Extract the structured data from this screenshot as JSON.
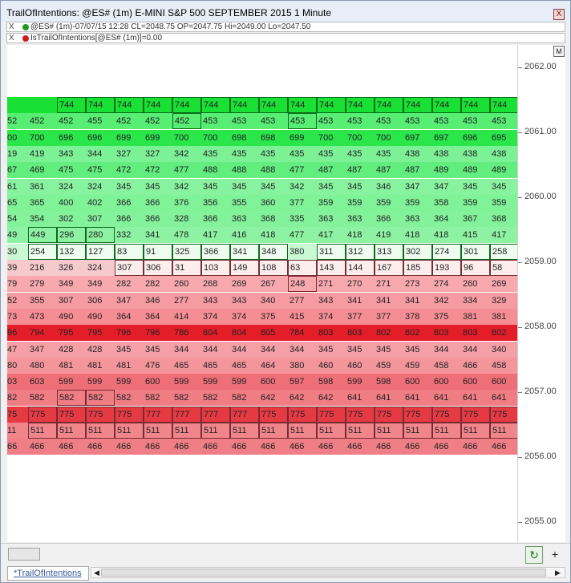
{
  "window": {
    "title": "TrailOfIntentions: @ES# (1m) E-MINI S&P 500 SEPTEMBER 2015 1 Minute",
    "close_label": "X"
  },
  "series": [
    {
      "close_label": "X",
      "dot_color": "#1f9b1f",
      "text": "@ES# (1m)-07/07/15 12:28 CL=2048.75 OP=2047.75 Hi=2049.00 Lo=2047.50"
    },
    {
      "close_label": "X",
      "dot_color": "#d01a1a",
      "text": "IsTrailOfIntentions[@ES# (1m)]=0.00"
    }
  ],
  "axis": {
    "m_label": "M",
    "labels": [
      "2062.00",
      "2061.00",
      "2060.00",
      "2059.00",
      "2058.00",
      "2057.00",
      "2056.00",
      "2055.00"
    ]
  },
  "heatmap": {
    "columns": 18,
    "rows": [
      {
        "bg": "#18e034",
        "values": [
          "",
          "",
          "744",
          "744",
          "744",
          "744",
          "744",
          "744",
          "744",
          "744",
          "744",
          "744",
          "744",
          "744",
          "744",
          "744",
          "744",
          "744"
        ],
        "boxed": [
          2,
          3,
          4,
          5,
          6,
          7,
          8,
          9,
          10,
          11,
          12,
          13,
          14,
          15,
          16,
          17
        ]
      },
      {
        "bg": "#57ee73",
        "values": [
          "52",
          "452",
          "452",
          "455",
          "452",
          "452",
          "452",
          "453",
          "453",
          "453",
          "453",
          "453",
          "453",
          "453",
          "453",
          "453",
          "453",
          "453"
        ],
        "boxed": [
          6,
          10
        ]
      },
      {
        "bg": "#2ae64b",
        "values": [
          "00",
          "700",
          "696",
          "696",
          "699",
          "699",
          "700",
          "700",
          "698",
          "698",
          "699",
          "700",
          "700",
          "700",
          "697",
          "697",
          "696",
          "695"
        ],
        "boxed": []
      },
      {
        "bg": "#7cf195",
        "values": [
          "19",
          "419",
          "343",
          "344",
          "327",
          "327",
          "342",
          "435",
          "435",
          "435",
          "435",
          "435",
          "435",
          "435",
          "438",
          "438",
          "438",
          "438"
        ],
        "boxed": []
      },
      {
        "bg": "#62ee7e",
        "values": [
          "67",
          "469",
          "475",
          "475",
          "472",
          "472",
          "477",
          "488",
          "488",
          "488",
          "477",
          "487",
          "487",
          "487",
          "487",
          "489",
          "489",
          "489"
        ],
        "boxed": []
      },
      {
        "bg": "#88f39e",
        "values": [
          "61",
          "361",
          "324",
          "324",
          "345",
          "345",
          "342",
          "345",
          "345",
          "345",
          "342",
          "345",
          "345",
          "346",
          "347",
          "347",
          "345",
          "345"
        ],
        "boxed": []
      },
      {
        "bg": "#80f298",
        "values": [
          "65",
          "365",
          "400",
          "402",
          "366",
          "366",
          "376",
          "356",
          "355",
          "360",
          "377",
          "359",
          "359",
          "359",
          "359",
          "358",
          "359",
          "359"
        ],
        "boxed": []
      },
      {
        "bg": "#84f29b",
        "values": [
          "54",
          "354",
          "302",
          "307",
          "366",
          "366",
          "328",
          "366",
          "363",
          "368",
          "335",
          "363",
          "363",
          "366",
          "363",
          "364",
          "367",
          "368"
        ],
        "boxed": []
      },
      {
        "bg": "#8df3a2",
        "values": [
          "49",
          "449",
          "296",
          "280",
          "332",
          "341",
          "478",
          "417",
          "416",
          "418",
          "477",
          "417",
          "418",
          "419",
          "418",
          "418",
          "415",
          "417"
        ],
        "boxed": [
          1,
          2,
          3
        ]
      },
      {
        "bg": "#c9f8d3",
        "values": [
          "30",
          "254",
          "132",
          "127",
          "83",
          "91",
          "325",
          "366",
          "341",
          "348",
          "380",
          "311",
          "312",
          "313",
          "302",
          "274",
          "301",
          "258"
        ],
        "boxed": [
          1,
          2,
          3,
          4,
          5,
          6,
          7,
          8,
          9,
          11,
          12,
          13,
          14,
          15,
          16,
          17
        ]
      },
      {
        "bg": "#f6c9cc",
        "values": [
          "39",
          "216",
          "326",
          "324",
          "307",
          "306",
          "31",
          "103",
          "149",
          "108",
          "63",
          "143",
          "144",
          "167",
          "185",
          "193",
          "96",
          "58"
        ],
        "boxed": [
          4,
          5,
          6,
          7,
          8,
          9,
          10,
          11,
          12,
          13,
          14,
          15,
          16,
          17
        ]
      },
      {
        "bg": "#f7a9ae",
        "values": [
          "79",
          "279",
          "349",
          "349",
          "282",
          "282",
          "260",
          "268",
          "269",
          "267",
          "248",
          "271",
          "270",
          "271",
          "273",
          "274",
          "260",
          "269"
        ],
        "boxed": [
          10
        ]
      },
      {
        "bg": "#f59ba1",
        "values": [
          "52",
          "355",
          "307",
          "306",
          "347",
          "346",
          "277",
          "343",
          "343",
          "340",
          "277",
          "343",
          "341",
          "341",
          "341",
          "342",
          "334",
          "329"
        ],
        "boxed": []
      },
      {
        "bg": "#f58d94",
        "values": [
          "73",
          "473",
          "490",
          "490",
          "364",
          "364",
          "414",
          "374",
          "374",
          "375",
          "415",
          "374",
          "377",
          "377",
          "378",
          "375",
          "381",
          "381"
        ],
        "boxed": []
      },
      {
        "bg": "#e41e28",
        "values": [
          "96",
          "794",
          "795",
          "795",
          "796",
          "796",
          "786",
          "804",
          "804",
          "805",
          "784",
          "803",
          "803",
          "802",
          "802",
          "803",
          "803",
          "802"
        ],
        "boxed": []
      },
      {
        "bg": "#f4a0a6",
        "values": [
          "47",
          "347",
          "428",
          "428",
          "345",
          "345",
          "344",
          "344",
          "344",
          "344",
          "344",
          "345",
          "345",
          "345",
          "345",
          "344",
          "344",
          "340"
        ],
        "boxed": []
      },
      {
        "bg": "#f3959b",
        "values": [
          "80",
          "480",
          "481",
          "481",
          "481",
          "476",
          "465",
          "465",
          "465",
          "464",
          "380",
          "460",
          "460",
          "459",
          "459",
          "458",
          "466",
          "458"
        ],
        "boxed": []
      },
      {
        "bg": "#ee6f78",
        "values": [
          "03",
          "603",
          "599",
          "599",
          "599",
          "600",
          "599",
          "599",
          "599",
          "600",
          "597",
          "598",
          "599",
          "598",
          "600",
          "600",
          "600",
          "600"
        ],
        "boxed": []
      },
      {
        "bg": "#f07c84",
        "values": [
          "82",
          "582",
          "582",
          "582",
          "582",
          "582",
          "582",
          "582",
          "582",
          "642",
          "642",
          "642",
          "641",
          "641",
          "641",
          "641",
          "641",
          "641"
        ],
        "boxed": [
          2,
          3
        ]
      },
      {
        "bg": "#e63a43",
        "values": [
          "75",
          "775",
          "775",
          "775",
          "775",
          "777",
          "777",
          "777",
          "777",
          "775",
          "775",
          "775",
          "775",
          "775",
          "775",
          "775",
          "775",
          "775"
        ],
        "boxed": [
          1,
          2,
          3,
          4,
          5,
          6,
          7,
          8,
          9,
          10,
          11,
          12,
          13,
          14,
          15,
          16,
          17
        ]
      },
      {
        "bg": "#f0858c",
        "values": [
          "11",
          "511",
          "511",
          "511",
          "511",
          "511",
          "511",
          "511",
          "511",
          "511",
          "511",
          "511",
          "511",
          "511",
          "511",
          "511",
          "511",
          "511"
        ],
        "boxed": [
          1,
          2,
          3,
          4,
          5,
          6,
          7,
          8,
          9,
          10,
          11,
          12,
          13,
          14,
          15,
          16,
          17
        ]
      },
      {
        "bg": "#ef7e86",
        "values": [
          "66",
          "466",
          "466",
          "466",
          "466",
          "466",
          "466",
          "466",
          "466",
          "466",
          "466",
          "466",
          "466",
          "466",
          "466",
          "466",
          "466",
          "466"
        ],
        "boxed": []
      }
    ]
  },
  "bottom": {
    "refresh_label": "↻",
    "plus_label": "+"
  },
  "tabs": [
    {
      "label": "*TrailOfIntentions"
    }
  ],
  "scrollbar": {
    "left_arrow": "◀",
    "right_arrow": "▶"
  }
}
